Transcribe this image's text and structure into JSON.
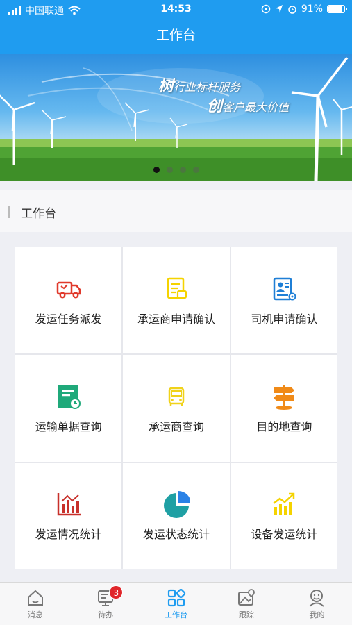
{
  "status": {
    "carrier": "中国联通",
    "time": "14:53",
    "battery": "91%",
    "battery_level": 0.91
  },
  "header": {
    "title": "工作台"
  },
  "banner": {
    "slogan1_big": "树",
    "slogan1_rest": "行业标杆服务",
    "slogan2_big": "创",
    "slogan2_rest": "客户最大价值",
    "active_index": 0,
    "count": 4
  },
  "section": {
    "title": "工作台"
  },
  "grid": [
    {
      "label": "发运任务派发",
      "icon": "truck-icon",
      "color": "#e0392b"
    },
    {
      "label": "承运商申请确认",
      "icon": "document-edit-icon",
      "color": "#f5d300"
    },
    {
      "label": "司机申请确认",
      "icon": "driver-profile-icon",
      "color": "#1f7fd6"
    },
    {
      "label": "运输单据查询",
      "icon": "waybill-clock-icon",
      "color": "#1fa97a"
    },
    {
      "label": "承运商查询",
      "icon": "vehicle-front-icon",
      "color": "#f0d21a"
    },
    {
      "label": "目的地查询",
      "icon": "signpost-icon",
      "color": "#f08a18"
    },
    {
      "label": "发运情况统计",
      "icon": "bar-chart-icon",
      "color": "#c8302a"
    },
    {
      "label": "发运状态统计",
      "icon": "pie-chart-icon",
      "color": "#1fa0a4"
    },
    {
      "label": "设备发运统计",
      "icon": "trend-chart-icon",
      "color": "#f5d300"
    }
  ],
  "tabs": [
    {
      "label": "消息",
      "icon": "home-icon"
    },
    {
      "label": "待办",
      "icon": "todo-icon",
      "badge": "3"
    },
    {
      "label": "工作台",
      "icon": "grid-icon",
      "active": true
    },
    {
      "label": "跟踪",
      "icon": "map-pin-icon"
    },
    {
      "label": "我的",
      "icon": "user-icon"
    }
  ]
}
